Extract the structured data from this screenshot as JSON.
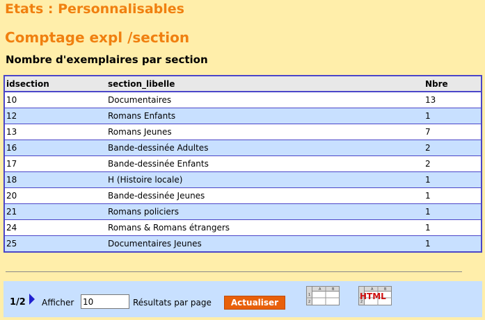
{
  "header": {
    "title": "Etats : Personnalisables",
    "report_title": "Comptage expl /section",
    "subtitle": "Nombre d'exemplaires par section"
  },
  "table": {
    "columns": [
      "idsection",
      "section_libelle",
      "Nbre"
    ],
    "rows": [
      {
        "idsection": "10",
        "section_libelle": "Documentaires",
        "nbre": "13"
      },
      {
        "idsection": "12",
        "section_libelle": "Romans Enfants",
        "nbre": "1"
      },
      {
        "idsection": "13",
        "section_libelle": "Romans Jeunes",
        "nbre": "7"
      },
      {
        "idsection": "16",
        "section_libelle": "Bande-dessinée Adultes",
        "nbre": "2"
      },
      {
        "idsection": "17",
        "section_libelle": "Bande-dessinée Enfants",
        "nbre": "2"
      },
      {
        "idsection": "18",
        "section_libelle": "H (Histoire locale)",
        "nbre": "1"
      },
      {
        "idsection": "20",
        "section_libelle": "Bande-dessinée Jeunes",
        "nbre": "1"
      },
      {
        "idsection": "21",
        "section_libelle": "Romans policiers",
        "nbre": "1"
      },
      {
        "idsection": "24",
        "section_libelle": "Romans & Romans étrangers",
        "nbre": "1"
      },
      {
        "idsection": "25",
        "section_libelle": "Documentaires Jeunes",
        "nbre": "1"
      }
    ]
  },
  "footer": {
    "page_indicator": "1/2",
    "show_label": "Afficher",
    "per_page_value": "10",
    "results_label": "Résultats par page",
    "refresh_label": "Actualiser",
    "html_icon_text": "HTML",
    "spreadsheet_cols": [
      "A",
      "B"
    ],
    "spreadsheet_rows": [
      "1",
      "2"
    ]
  },
  "colors": {
    "page_bg": "#ffeeaa",
    "title": "#f08010",
    "table_border": "#4a45c8",
    "alt_row": "#c8e0ff",
    "button": "#e8600a"
  }
}
